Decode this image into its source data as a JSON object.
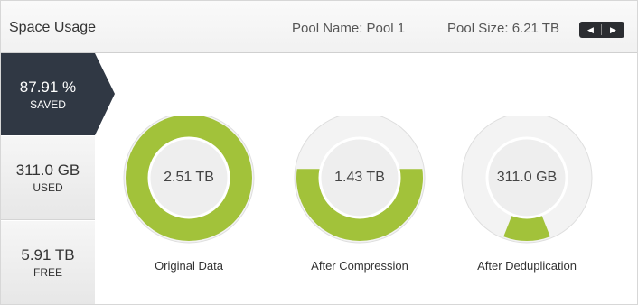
{
  "header": {
    "title": "Space Usage",
    "pool_name": "Pool Name: Pool 1",
    "pool_size": "Pool Size: 6.21 TB",
    "prev_icon": "caret-left-icon",
    "next_icon": "caret-right-icon"
  },
  "stats": {
    "saved": {
      "value": "87.91 %",
      "label": "SAVED"
    },
    "used": {
      "value": "311.0 GB",
      "label": "USED"
    },
    "free": {
      "value": "5.91 TB",
      "label": "FREE"
    }
  },
  "donuts": [
    {
      "value": "2.51 TB",
      "label": "Original Data",
      "fill_fraction": 1.0
    },
    {
      "value": "1.43 TB",
      "label": "After Compression",
      "fill_fraction": 0.57
    },
    {
      "value": "311.0 GB",
      "label": "After Deduplication",
      "fill_fraction": 0.12
    }
  ],
  "colors": {
    "accent": "#a2c23a",
    "track": "#eeeeee",
    "saved_bg": "#303844"
  }
}
